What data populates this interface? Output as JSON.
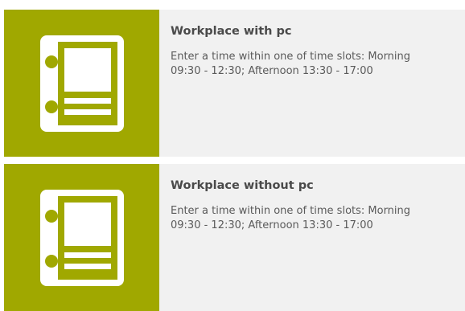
{
  "accent_color": "#a0a800",
  "cards": [
    {
      "icon": "workplace-icon",
      "title": "Workplace with pc",
      "description": "Enter a time within one of time slots: Morning\n09:30 - 12:30; Afternoon 13:30 - 17:00"
    },
    {
      "icon": "workplace-icon",
      "title": "Workplace without pc",
      "description": "Enter a time within one of time slots: Morning\n09:30 - 12:30; Afternoon 13:30 - 17:00"
    }
  ]
}
